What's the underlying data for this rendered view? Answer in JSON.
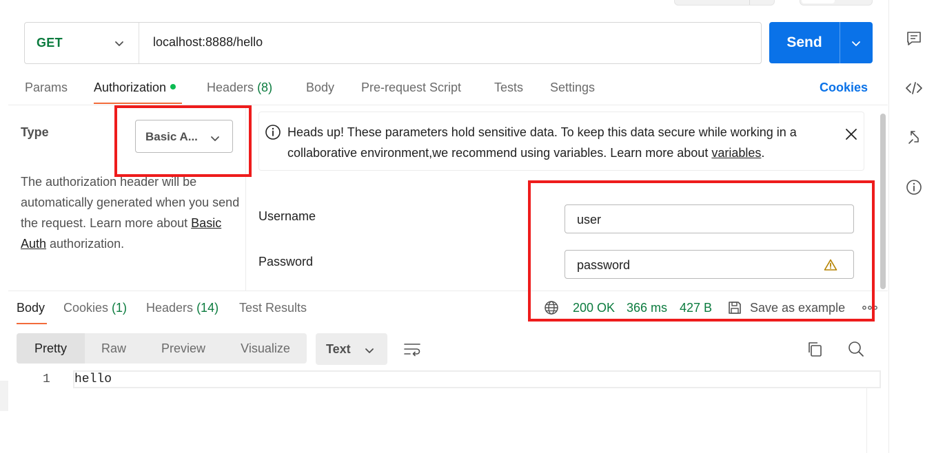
{
  "request": {
    "method": "GET",
    "url": "localhost:8888/hello",
    "send_label": "Send"
  },
  "request_tabs": {
    "params": "Params",
    "authorization": "Authorization",
    "headers": "Headers",
    "headers_count": "(8)",
    "body": "Body",
    "pre_request_script": "Pre-request Script",
    "tests": "Tests",
    "settings": "Settings",
    "cookies": "Cookies"
  },
  "auth": {
    "type_label": "Type",
    "type_value": "Basic A...",
    "desc_before": "The authorization header will be automatically generated when you send the request. Learn more about ",
    "desc_link": "Basic Auth",
    "desc_after": " authorization.",
    "alert_text": "Heads up! These parameters hold sensitive data. To keep this data secure while working in a collaborative environment,we recommend using variables. Learn more about ",
    "alert_link": "variables",
    "alert_end": ".",
    "username_label": "Username",
    "username_value": "user",
    "password_label": "Password",
    "password_value": "password"
  },
  "response": {
    "tabs": {
      "body": "Body",
      "cookies": "Cookies",
      "cookies_count": "(1)",
      "headers": "Headers",
      "headers_count": "(14)",
      "test_results": "Test Results"
    },
    "status": "200 OK",
    "time": "366 ms",
    "size": "427 B",
    "save_example": "Save as example",
    "views": [
      "Pretty",
      "Raw",
      "Preview",
      "Visualize"
    ],
    "format": "Text",
    "lines": [
      {
        "number": "1",
        "text": "hello"
      }
    ]
  },
  "colors": {
    "accent": "#0a72e8",
    "method_green": "#0b7b3e",
    "tab_underline": "#f26b3a",
    "annotation_red": "#ee1c1c"
  },
  "icons": [
    "chevron-down-icon",
    "info-icon",
    "close-icon",
    "warning-icon",
    "globe-icon",
    "save-icon",
    "more-icon",
    "wrap-lines-icon",
    "copy-icon",
    "search-icon",
    "comment-icon",
    "code-icon",
    "pin-icon",
    "right-info-icon"
  ]
}
